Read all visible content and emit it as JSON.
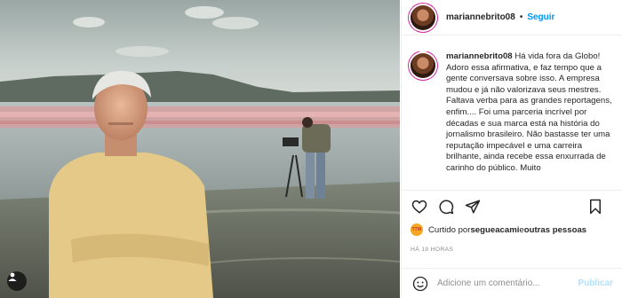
{
  "post": {
    "username": "mariannebrito08",
    "separator": "•",
    "follow_label": "Seguir"
  },
  "caption": {
    "username": "mariannebrito08",
    "text": "Há vida fora da Globo! Adoro essa afirmativa, e faz tempo que a gente conversava sobre isso. A empresa mudou e já não valorizava seus mestres. Faltava verba para as grandes reportagens, enfim.... Foi uma parceria incrível por décadas e sua marca está na história do jornalismo brasileiro. Não bastasse ter uma reputação impecável e uma carreira brilhante, ainda recebe essa enxurrada de carinho do público. Muito"
  },
  "likes": {
    "prefix": "Curtido por ",
    "user": "segueacami",
    "middle": " e ",
    "others": "outras pessoas",
    "avatar_text": "TTW"
  },
  "timestamp": "HÁ 19 HORAS",
  "comment": {
    "placeholder": "Adicione um comentário...",
    "publish_label": "Publicar"
  },
  "icons": {
    "photo_user_tag": "user-tag-icon",
    "like": "heart-icon",
    "comment": "comment-icon",
    "share": "share-icon",
    "save": "bookmark-icon",
    "emoji": "emoji-icon"
  },
  "colors": {
    "follow": "#0095f6",
    "publish_disabled": "#b2dffc",
    "muted": "#8e8e8e"
  }
}
